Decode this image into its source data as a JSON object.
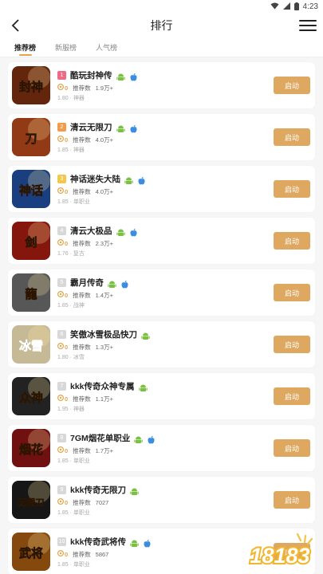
{
  "status": {
    "time": "4:23"
  },
  "header": {
    "title": "排行"
  },
  "tabs": [
    {
      "label": "推荐榜"
    },
    {
      "label": "新服榜"
    },
    {
      "label": "人气榜"
    }
  ],
  "colors": {
    "accent": "#dfa861",
    "rank1": "#f06a86",
    "rank2": "#f29b4b",
    "rank3": "#f2c84b",
    "rank_other": "#d8d8d8",
    "android": "#7ac043",
    "apple": "#3a8de0"
  },
  "rank_label": "推荐数",
  "start_label": "启动",
  "games": [
    {
      "rank": "1",
      "name": "酷玩封神传",
      "coin": "0",
      "count": "1.9万+",
      "version": "1.80",
      "tag": "神器",
      "ios": true,
      "icon": "fengshen-icon",
      "bg": "#7a2e10",
      "glyph": "封神"
    },
    {
      "rank": "2",
      "name": "清云无限刀",
      "coin": "0",
      "count": "4.0万+",
      "version": "1.85",
      "tag": "神器",
      "ios": true,
      "icon": "qingyun-wuxiandao-icon",
      "bg": "#b2471a",
      "glyph": "刀"
    },
    {
      "rank": "3",
      "name": "神话迷失大陆",
      "coin": "0",
      "count": "4.0万+",
      "version": "1.85",
      "tag": "单职业",
      "ios": true,
      "icon": "shenhua-mishi-icon",
      "bg": "#1f4e9e",
      "glyph": "神话"
    },
    {
      "rank": "4",
      "name": "清云大极品",
      "coin": "0",
      "count": "2.3万+",
      "version": "1.76",
      "tag": "复古",
      "ios": true,
      "icon": "qingyun-dajipin-icon",
      "bg": "#a11b10",
      "glyph": "剑"
    },
    {
      "rank": "5",
      "name": "霸月传奇",
      "coin": "0",
      "count": "1.4万+",
      "version": "1.85",
      "tag": "战神",
      "ios": true,
      "icon": "bayue-chuanqi-icon",
      "bg": "#6b6b6b",
      "glyph": "龍"
    },
    {
      "rank": "6",
      "name": "笑傲冰雪极品快刀",
      "coin": "0",
      "count": "1.3万+",
      "version": "1.80",
      "tag": "冰雪",
      "ios": false,
      "icon": "xiaoao-bingxue-icon",
      "bg": "#f2e2b8",
      "glyph": "冰雪"
    },
    {
      "rank": "7",
      "name": "kkk传奇众神专属",
      "coin": "0",
      "count": "1.1万+",
      "version": "1.95",
      "tag": "神器",
      "ios": false,
      "icon": "kkk-zhongshen-icon",
      "bg": "#2a2a2a",
      "glyph": "众神"
    },
    {
      "rank": "8",
      "name": "7GM烟花单职业",
      "coin": "0",
      "count": "1.7万+",
      "version": "1.85",
      "tag": "单职业",
      "ios": true,
      "icon": "yanhua-icon",
      "bg": "#8a1414",
      "glyph": "烟花"
    },
    {
      "rank": "9",
      "name": "kkk传奇无限刀",
      "coin": "0",
      "count": "7027",
      "version": "1.85",
      "tag": "单职业",
      "ios": false,
      "icon": "kkk-wuxiandao-icon",
      "bg": "#1c1c1c",
      "glyph": "无限刀"
    },
    {
      "rank": "10",
      "name": "kkk传奇武将传",
      "coin": "0",
      "count": "5867",
      "version": "1.85",
      "tag": "单职业",
      "ios": true,
      "icon": "kkk-wujiang-icon",
      "bg": "#a35a12",
      "glyph": "武将"
    }
  ],
  "watermark": {
    "text": "18183"
  }
}
